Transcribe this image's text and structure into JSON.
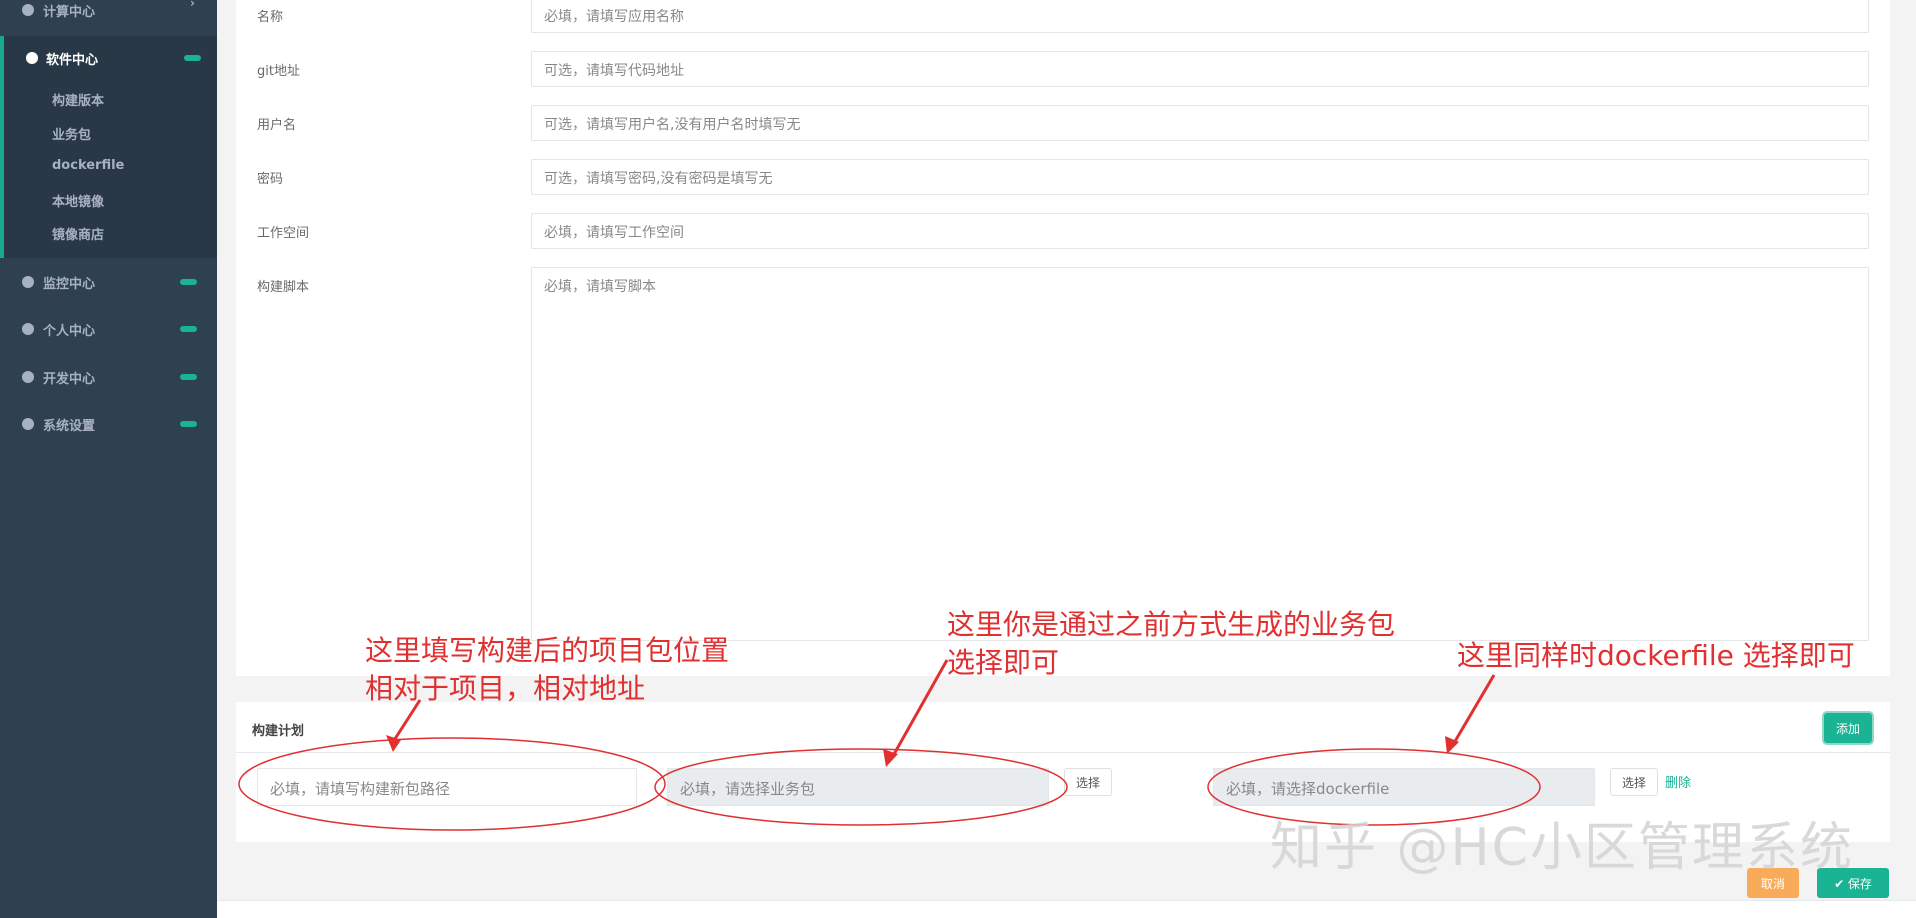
{
  "sidebar": {
    "items": [
      {
        "label": "计算中心"
      },
      {
        "label": "软件中心"
      },
      {
        "label": "监控中心"
      },
      {
        "label": "个人中心"
      },
      {
        "label": "开发中心"
      },
      {
        "label": "系统设置"
      }
    ],
    "subitems": [
      {
        "label": "构建版本"
      },
      {
        "label": "业务包"
      },
      {
        "label": "dockerfile"
      },
      {
        "label": "本地镜像"
      },
      {
        "label": "镜像商店"
      }
    ],
    "chevron": "›"
  },
  "form": {
    "fields": [
      {
        "label": "名称",
        "placeholder": "必填，请填写应用名称"
      },
      {
        "label": "git地址",
        "placeholder": "可选，请填写代码地址"
      },
      {
        "label": "用户名",
        "placeholder": "可选，请填写用户名,没有用户名时填写无"
      },
      {
        "label": "密码",
        "placeholder": "可选，请填写密码,没有密码是填写无"
      },
      {
        "label": "工作空间",
        "placeholder": "必填，请填写工作空间"
      },
      {
        "label": "构建脚本",
        "placeholder": "必填，请填写脚本"
      }
    ]
  },
  "plan": {
    "title": "构建计划",
    "add_label": "添加",
    "path_placeholder": "必填，请填写构建新包路径",
    "package_placeholder": "必填，请选择业务包",
    "select1_label": "选择",
    "dockerfile_placeholder": "必填，请选择dockerfile",
    "select2_label": "选择",
    "delete_label": "删除"
  },
  "actions": {
    "cancel_label": "取消",
    "save_label": "✔ 保存"
  },
  "annotations": {
    "a1_line1": "这里填写构建后的项目包位置",
    "a1_line2": "相对于项目，相对地址",
    "a2_line1": "这里你是通过之前方式生成的业务包",
    "a2_line2": "选择即可",
    "a3": "这里同样时dockerfile 选择即可"
  },
  "watermark": "知乎 @HC小区管理系统",
  "colors": {
    "sidebar": "#2f4050",
    "accent": "#1ab394",
    "annotation": "#e03030",
    "warning": "#f8ac59"
  }
}
